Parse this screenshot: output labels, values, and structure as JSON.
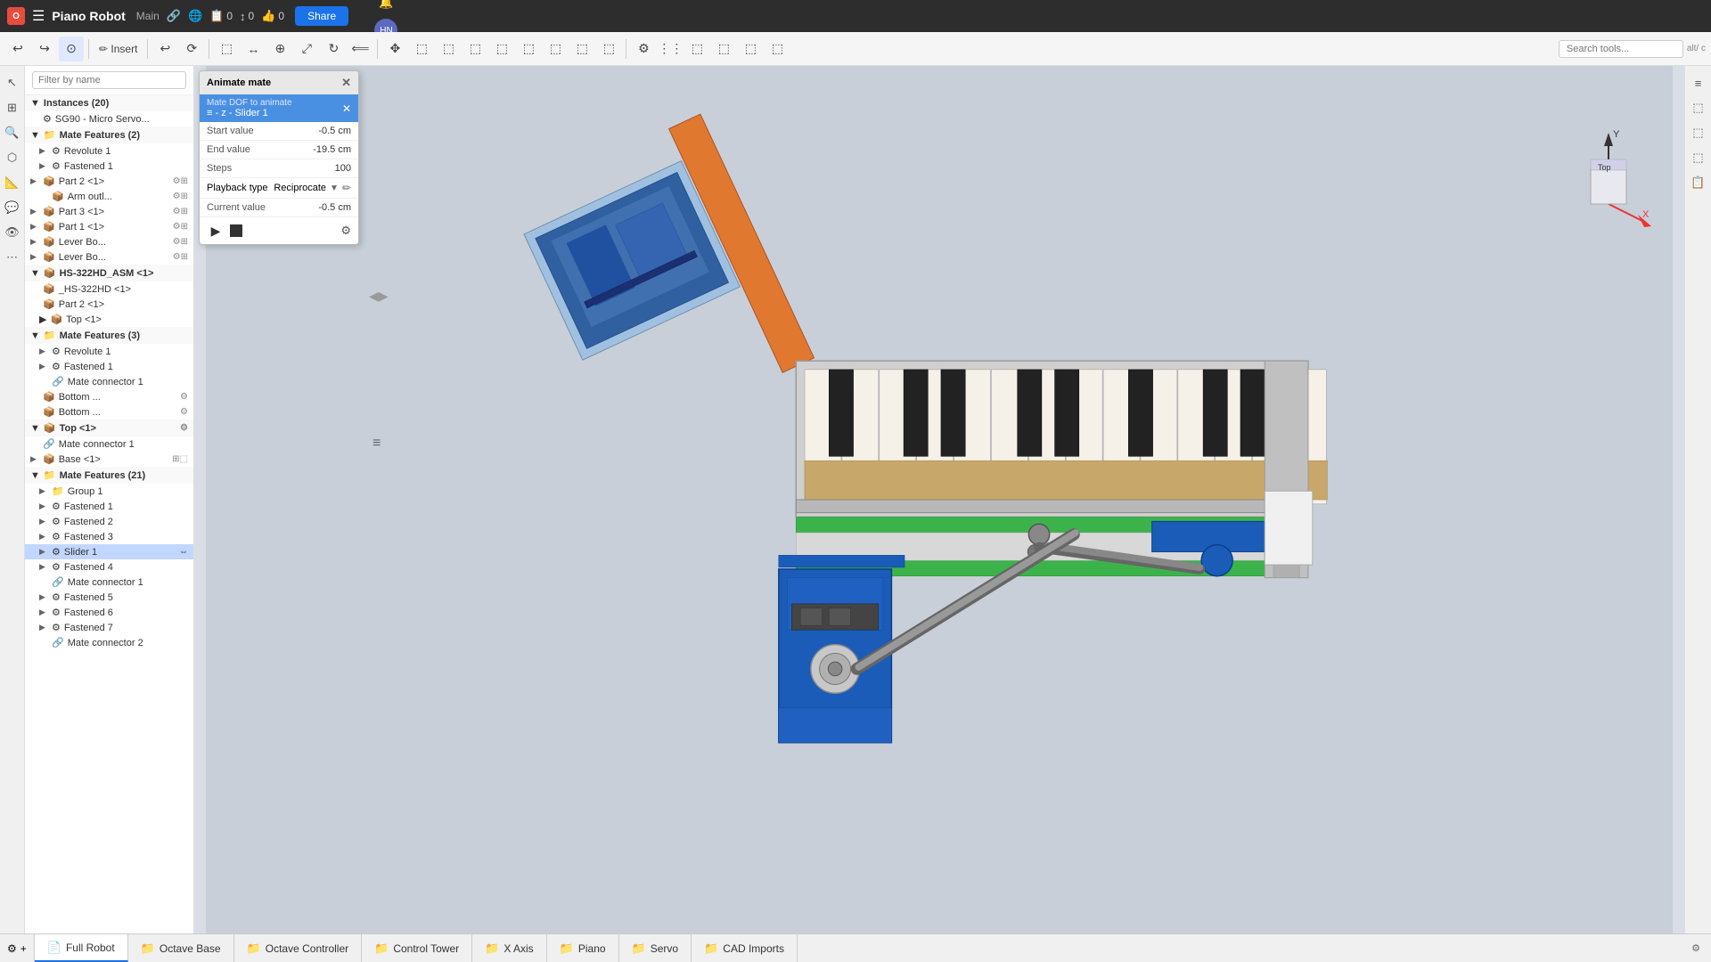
{
  "topbar": {
    "logo": "O",
    "menu_icon": "☰",
    "app_name": "Piano Robot",
    "doc_section": "Main",
    "link_icon": "🔗",
    "globe_icon": "🌐",
    "counters": [
      {
        "icon": "📋",
        "value": "0"
      },
      {
        "icon": "↕",
        "value": "0"
      },
      {
        "icon": "👍",
        "value": "0"
      }
    ],
    "share_label": "Share",
    "help_icon": "?",
    "user_name": "Hazel Nut",
    "notification_icon": "🔔"
  },
  "toolbar": {
    "buttons": [
      "↩",
      "↪",
      "⊙",
      "✏",
      "↩",
      "⟳",
      "⟵",
      "⟷",
      "⊕",
      "⤢",
      "↻",
      "⟸",
      "↗",
      "⬚",
      "⬚",
      "⬚",
      "⬚",
      "⬚",
      "⬚",
      "⬚",
      "⬚",
      "⬚",
      "⬚",
      "⬚",
      "⬚",
      "⬚",
      "⬚"
    ],
    "search_placeholder": "Search tools...",
    "search_shortcut": "alt/ c"
  },
  "panel": {
    "search_placeholder": "Filter by name",
    "instances_label": "Instances (20)",
    "items": [
      {
        "id": "sg90",
        "label": "SG90 - Micro Servo...",
        "level": 1,
        "icon": "⚙",
        "expand": false
      },
      {
        "id": "mate-features-2",
        "label": "Mate Features (2)",
        "level": 1,
        "icon": "📁",
        "expand": true,
        "expanded": true
      },
      {
        "id": "revolute-1",
        "label": "Revolute 1",
        "level": 2,
        "icon": "⚙",
        "expand": true
      },
      {
        "id": "fastened-1a",
        "label": "Fastened 1",
        "level": 2,
        "icon": "⚙",
        "expand": false
      },
      {
        "id": "part-2-1",
        "label": "Part 2 <1>",
        "level": 1,
        "icon": "📦",
        "expand": false
      },
      {
        "id": "arm-outl",
        "label": "Arm outl...",
        "level": 2,
        "icon": "📦",
        "expand": false
      },
      {
        "id": "part-3-1",
        "label": "Part 3 <1>",
        "level": 1,
        "icon": "📦",
        "expand": false
      },
      {
        "id": "part-1-1",
        "label": "Part 1 <1>",
        "level": 1,
        "icon": "📦",
        "expand": false
      },
      {
        "id": "lever-bo-1",
        "label": "Lever Bo...",
        "level": 1,
        "icon": "📦",
        "expand": false
      },
      {
        "id": "lever-bo-2",
        "label": "Lever Bo...",
        "level": 1,
        "icon": "📦",
        "expand": false
      },
      {
        "id": "hs-322hd",
        "label": "HS-322HD_ASM <1>",
        "level": 1,
        "icon": "📦",
        "expand": true,
        "expanded": true
      },
      {
        "id": "hs-322hd-inner",
        "label": "_HS-322HD <1>",
        "level": 2,
        "icon": "📦",
        "expand": false
      },
      {
        "id": "part-2-1b",
        "label": "Part 2 <1>",
        "level": 2,
        "icon": "📦",
        "expand": false
      },
      {
        "id": "top-1",
        "label": "Top <1>",
        "level": 2,
        "icon": "📦",
        "expand": false
      },
      {
        "id": "mate-features-3",
        "label": "Mate Features (3)",
        "level": 1,
        "icon": "📁",
        "expand": true,
        "expanded": true
      },
      {
        "id": "revolute-1b",
        "label": "Revolute 1",
        "level": 2,
        "icon": "⚙",
        "expand": true
      },
      {
        "id": "fastened-1c",
        "label": "Fastened 1",
        "level": 2,
        "icon": "⚙",
        "expand": true
      },
      {
        "id": "mate-connector-1a",
        "label": "Mate connector 1",
        "level": 3,
        "icon": "🔗",
        "expand": false
      },
      {
        "id": "bottom-1",
        "label": "Bottom ...",
        "level": 1,
        "icon": "📦",
        "expand": false
      },
      {
        "id": "bottom-2",
        "label": "Bottom ...",
        "level": 1,
        "icon": "📦",
        "expand": false
      },
      {
        "id": "top-1b",
        "label": "Top <1>",
        "level": 1,
        "icon": "📦",
        "expand": true,
        "expanded": true
      },
      {
        "id": "mate-connector-1b",
        "label": "Mate connector 1",
        "level": 2,
        "icon": "🔗",
        "expand": false
      },
      {
        "id": "base-1",
        "label": "Base <1>",
        "level": 1,
        "icon": "📦",
        "expand": false
      },
      {
        "id": "mate-features-21",
        "label": "Mate Features (21)",
        "level": 1,
        "icon": "📁",
        "expand": true,
        "expanded": true
      },
      {
        "id": "group-1",
        "label": "Group 1",
        "level": 2,
        "icon": "📁",
        "expand": true
      },
      {
        "id": "fastened-1d",
        "label": "Fastened 1",
        "level": 2,
        "icon": "⚙",
        "expand": true
      },
      {
        "id": "fastened-2",
        "label": "Fastened 2",
        "level": 2,
        "icon": "⚙",
        "expand": false
      },
      {
        "id": "fastened-3",
        "label": "Fastened 3",
        "level": 2,
        "icon": "⚙",
        "expand": false
      },
      {
        "id": "slider-1",
        "label": "Slider 1",
        "level": 2,
        "icon": "⚙",
        "expand": true,
        "selected": true
      },
      {
        "id": "fastened-4",
        "label": "Fastened 4",
        "level": 2,
        "icon": "⚙",
        "expand": true
      },
      {
        "id": "mate-connector-1c",
        "label": "Mate connector 1",
        "level": 3,
        "icon": "🔗",
        "expand": false
      },
      {
        "id": "fastened-5",
        "label": "Fastened 5",
        "level": 2,
        "icon": "⚙",
        "expand": false
      },
      {
        "id": "fastened-6",
        "label": "Fastened 6",
        "level": 2,
        "icon": "⚙",
        "expand": false
      },
      {
        "id": "fastened-7",
        "label": "Fastened 7",
        "level": 2,
        "icon": "⚙",
        "expand": false
      },
      {
        "id": "mate-connector-2",
        "label": "Mate connector 2",
        "level": 3,
        "icon": "🔗",
        "expand": false
      }
    ]
  },
  "animate_dialog": {
    "title": "Animate mate",
    "close_x": "✕",
    "dof_section_label": "Mate DOF to animate",
    "dof_value": "≡ - z - Slider 1",
    "dof_close": "✕",
    "fields": [
      {
        "label": "Start value",
        "value": "-0.5 cm"
      },
      {
        "label": "End value",
        "value": "-19.5 cm"
      },
      {
        "label": "Steps",
        "value": "100"
      },
      {
        "label": "Playback type",
        "value": "Reciprocate"
      },
      {
        "label": "Current value",
        "value": "-0.5 cm"
      }
    ],
    "play_icon": "▶",
    "stop_icon": "■",
    "settings_icon": "⚙"
  },
  "viewport": {
    "background": "#c8cfd8"
  },
  "coord_widget": {
    "top_label": "Top",
    "x_label": "X",
    "y_label": "Y"
  },
  "status_bar": {
    "active_tab": "Full Robot",
    "tabs": [
      {
        "icon": "📄",
        "label": "Full Robot",
        "active": true
      },
      {
        "icon": "📁",
        "label": "Octave Base",
        "active": false
      },
      {
        "icon": "📁",
        "label": "Octave Controller",
        "active": false
      },
      {
        "icon": "📁",
        "label": "Control Tower",
        "active": false
      },
      {
        "icon": "📁",
        "label": "X Axis",
        "active": false
      },
      {
        "icon": "📁",
        "label": "Piano",
        "active": false
      },
      {
        "icon": "📁",
        "label": "Servo",
        "active": false
      },
      {
        "icon": "📁",
        "label": "CAD Imports",
        "active": false
      }
    ]
  },
  "right_sidebar": {
    "icons": [
      "🔍",
      "⬚",
      "⬚",
      "⬚",
      "⬚"
    ]
  }
}
